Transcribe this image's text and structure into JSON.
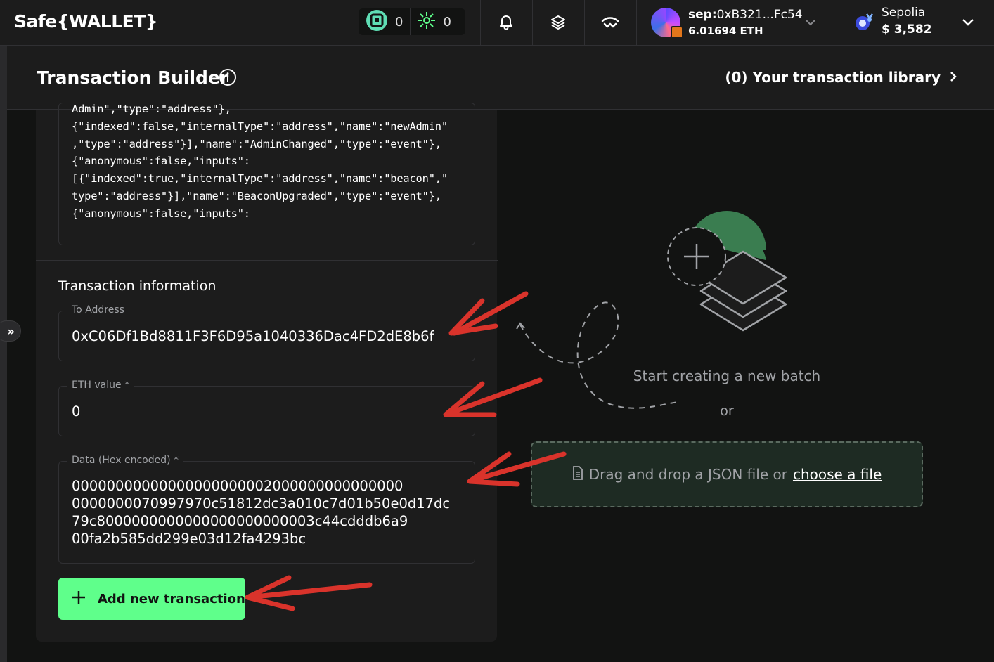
{
  "header": {
    "brand": "Safe{WALLET}",
    "counters": [
      {
        "icon": "safe-apps-icon",
        "value": "0"
      },
      {
        "icon": "star-burst-icon",
        "value": "0"
      }
    ],
    "account": {
      "prefix": "sep:",
      "address": "0xB321...Fc54",
      "balance": "6.01694 ETH"
    },
    "network": {
      "name": "Sepolia",
      "balance": "$ 3,582"
    }
  },
  "subheader": {
    "title": "Transaction Builder",
    "library_link": "(0) Your transaction library"
  },
  "abi_lines": [
    "Admin\",\"type\":\"address\"},",
    "{\"indexed\":false,\"internalType\":\"address\",\"name\":\"newAdmin\"",
    ",\"type\":\"address\"}],\"name\":\"AdminChanged\",\"type\":\"event\"},",
    "{\"anonymous\":false,\"inputs\":",
    "[{\"indexed\":true,\"internalType\":\"address\",\"name\":\"beacon\",\"",
    "type\":\"address\"}],\"name\":\"BeaconUpgraded\",\"type\":\"event\"},",
    "{\"anonymous\":false,\"inputs\":"
  ],
  "transaction_info": {
    "title": "Transaction information",
    "to_address": {
      "label": "To Address",
      "value": "0xC06Df1Bd8811F3F6D95a1040336Dac4FD2dE8b6f"
    },
    "eth_value": {
      "label": "ETH value *",
      "value": "0"
    },
    "data": {
      "label": "Data (Hex encoded) *",
      "lines": [
        "00000000000000000000002000000000000000",
        "0000000070997970c51812dc3a010c7d01b50e0d17dc",
        "79c8000000000000000000000003c44cdddb6a9",
        "00fa2b585dd299e03d12fa4293bc"
      ]
    },
    "add_button": "Add new transaction"
  },
  "empty_state": {
    "title": "Start creating a new batch",
    "or": "or",
    "drop_text": "Drag and drop a JSON file or",
    "choose_link": "choose a file"
  },
  "colors": {
    "accent_green": "#5fff8b",
    "annotation_red": "#d9332b",
    "background": "#121312",
    "panel": "#1c1c1c"
  }
}
